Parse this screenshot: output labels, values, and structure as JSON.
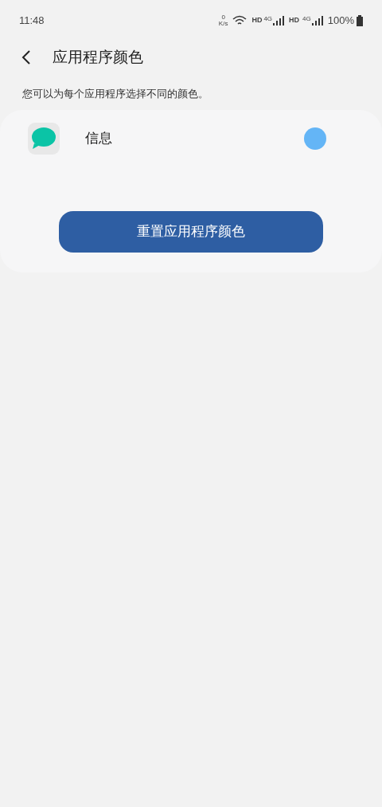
{
  "status_bar": {
    "time": "11:48",
    "speed_value": "0",
    "speed_unit": "K/s",
    "sim1_label": "HD",
    "sim1_network": "4G",
    "sim2_label": "HD",
    "sim2_network": "4G",
    "battery": "100%"
  },
  "header": {
    "title": "应用程序颜色"
  },
  "description": "您可以为每个应用程序选择不同的颜色。",
  "apps": [
    {
      "name": "信息",
      "color": "#64b5f6"
    }
  ],
  "reset_button": "重置应用程序颜色"
}
